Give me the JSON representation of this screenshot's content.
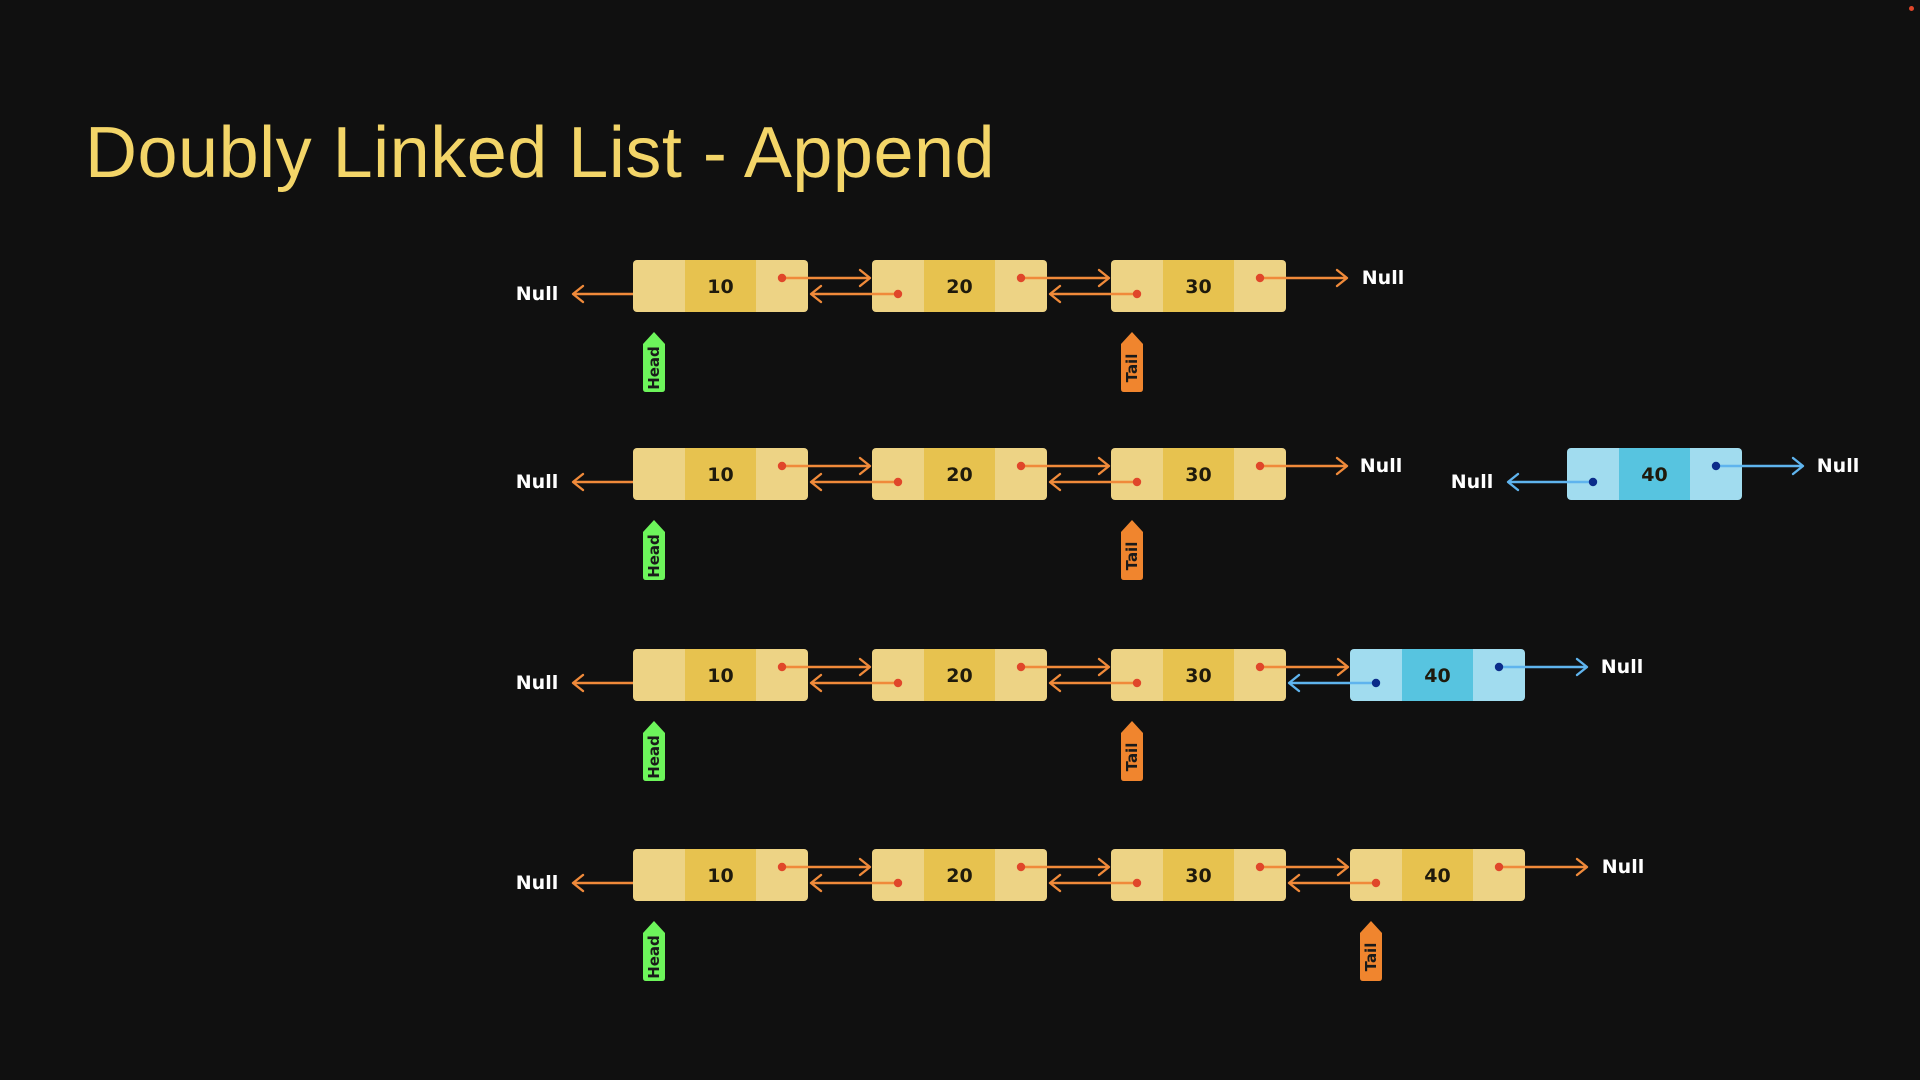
{
  "title": "Doubly Linked List - Append",
  "null_label": "Null",
  "head_label": "Head",
  "tail_label": "Tail",
  "colors": {
    "background": "#101010",
    "title": "#f3d568",
    "node_light": "#edd385",
    "node_mid": "#e7c24f",
    "new_node_light": "#a1dcef",
    "new_node_mid": "#57c4e0",
    "pointer_orange": "#f08a3a",
    "pointer_dot": "#e0462a",
    "pointer_blue": "#5fb4ee",
    "pointer_dot_blue": "#0b2c8a",
    "arrow_yellow": "#f6d57a",
    "head_tag": "#6df55b",
    "tail_tag": "#f0852e"
  },
  "steps": [
    {
      "list": [
        "10",
        "20",
        "30"
      ],
      "head_index": 0,
      "tail_index": 2
    },
    {
      "list": [
        "10",
        "20",
        "30"
      ],
      "new_node": "40",
      "head_index": 0,
      "tail_index": 2
    },
    {
      "list": [
        "10",
        "20",
        "30"
      ],
      "new_node": "40",
      "linked": true,
      "head_index": 0,
      "tail_index": 2
    },
    {
      "list": [
        "10",
        "20",
        "30",
        "40"
      ],
      "head_index": 0,
      "tail_index": 3
    }
  ]
}
